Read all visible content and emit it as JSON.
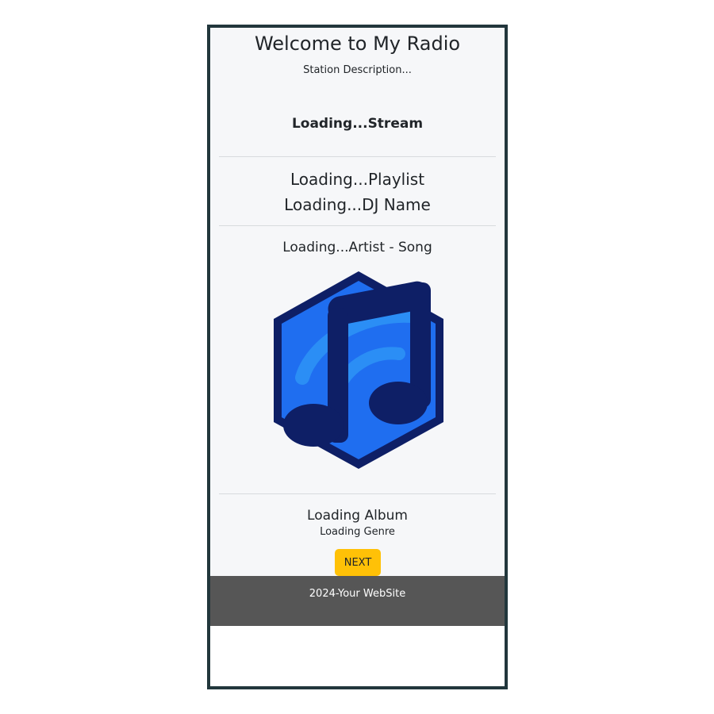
{
  "header": {
    "title": "Welcome to My Radio",
    "description": "Station Description..."
  },
  "stream": {
    "label": "Loading...Stream"
  },
  "program": {
    "playlist": "Loading...Playlist",
    "dj_name": "Loading...DJ Name"
  },
  "now_playing": {
    "artist_song": "Loading...Artist - Song",
    "album_art_icon": "music-note-hexagon-icon",
    "album": "Loading Album",
    "genre": "Loading Genre"
  },
  "controls": {
    "next_label": "NEXT"
  },
  "footer": {
    "text": "2024-Your WebSite"
  },
  "colors": {
    "frame_border": "#22373c",
    "panel_background": "#f6f7f9",
    "next_button": "#ffc107",
    "footer_background": "#565656",
    "art_dark": "#0e1f66",
    "art_blue": "#1f6ef0",
    "art_light": "#2b8ef5"
  }
}
